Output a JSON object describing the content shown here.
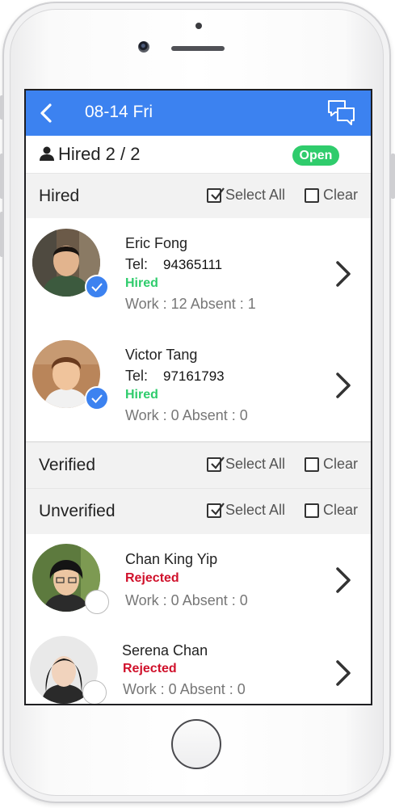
{
  "header": {
    "title": "08-14 Fri"
  },
  "summary": {
    "hired_count": "Hired 2 / 2",
    "badge": "Open"
  },
  "colors": {
    "accent": "#3c82f0",
    "open_badge": "#2fcc6c",
    "hired": "#2fcc6c",
    "rejected": "#d0112b"
  },
  "sections": {
    "hired": {
      "title": "Hired",
      "select_all": "Select All",
      "clear": "Clear"
    },
    "verified": {
      "title": "Verified",
      "select_all": "Select All",
      "clear": "Clear"
    },
    "unverified": {
      "title": "Unverified",
      "select_all": "Select All",
      "clear": "Clear"
    }
  },
  "workers": [
    {
      "name": "Eric Fong",
      "tel_label": "Tel:",
      "tel": "94365111",
      "status": "Hired",
      "work": "Work : 12 Absent : 1"
    },
    {
      "name": "Victor Tang",
      "tel_label": "Tel:",
      "tel": "97161793",
      "status": "Hired",
      "work": "Work : 0 Absent : 0"
    },
    {
      "name": "Chan King Yip",
      "status": "Rejected",
      "work": "Work : 0 Absent : 0"
    },
    {
      "name": "Serena Chan",
      "status": "Rejected",
      "work": "Work : 0 Absent : 0"
    }
  ]
}
